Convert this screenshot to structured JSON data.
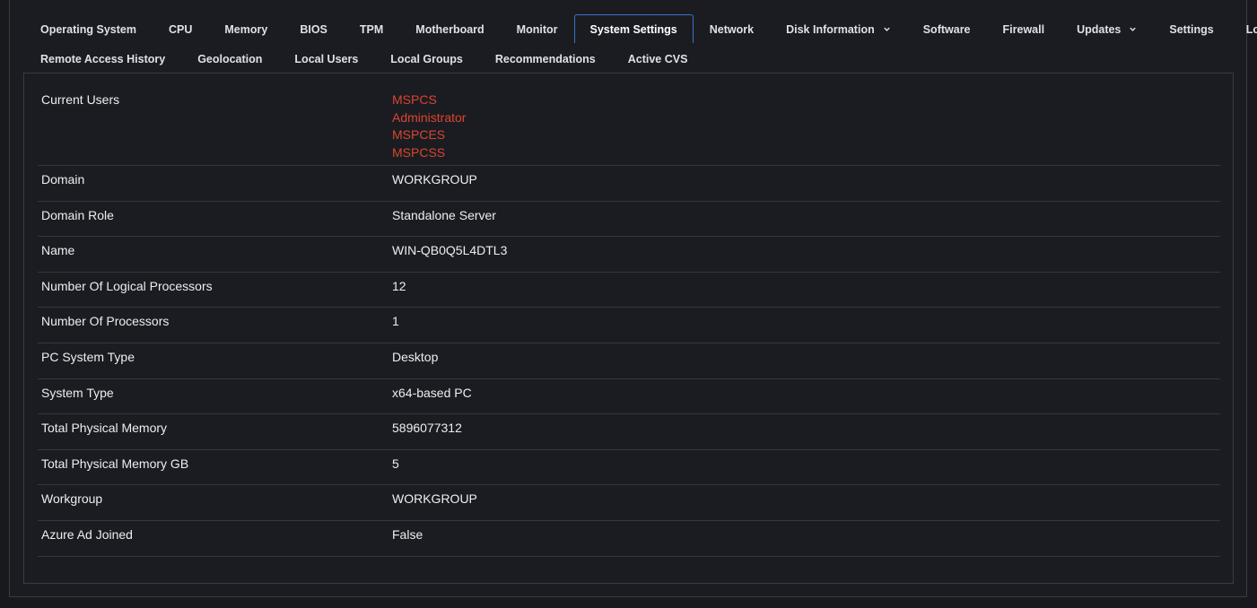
{
  "tabs": {
    "row1": [
      {
        "label": "Operating System"
      },
      {
        "label": "CPU"
      },
      {
        "label": "Memory"
      },
      {
        "label": "BIOS"
      },
      {
        "label": "TPM"
      },
      {
        "label": "Motherboard"
      },
      {
        "label": "Monitor"
      },
      {
        "label": "System Settings",
        "active": true
      },
      {
        "label": "Network"
      },
      {
        "label": "Disk Information",
        "dropdown": true
      },
      {
        "label": "Software"
      },
      {
        "label": "Firewall"
      },
      {
        "label": "Updates",
        "dropdown": true
      },
      {
        "label": "Settings"
      },
      {
        "label": "Location"
      }
    ],
    "row2": [
      {
        "label": "Remote Access History"
      },
      {
        "label": "Geolocation"
      },
      {
        "label": "Local Users"
      },
      {
        "label": "Local Groups"
      },
      {
        "label": "Recommendations"
      },
      {
        "label": "Active CVS"
      }
    ]
  },
  "system_settings": {
    "current_users": {
      "label": "Current Users",
      "values": [
        "MSPCS",
        "Administrator",
        "MSPCES",
        "MSPCSS"
      ]
    },
    "rows": [
      {
        "label": "Domain",
        "value": "WORKGROUP"
      },
      {
        "label": "Domain Role",
        "value": "Standalone Server"
      },
      {
        "label": "Name",
        "value": "WIN-QB0Q5L4DTL3"
      },
      {
        "label": "Number Of Logical Processors",
        "value": "12"
      },
      {
        "label": "Number Of Processors",
        "value": "1"
      },
      {
        "label": "PC System Type",
        "value": "Desktop"
      },
      {
        "label": "System Type",
        "value": "x64-based PC"
      },
      {
        "label": "Total Physical Memory",
        "value": "5896077312"
      },
      {
        "label": "Total Physical Memory GB",
        "value": "5"
      },
      {
        "label": "Workgroup",
        "value": "WORKGROUP"
      },
      {
        "label": "Azure Ad Joined",
        "value": "False"
      }
    ]
  },
  "colors": {
    "background": "#18191d",
    "active_tab_border": "#3e6fc9",
    "user_link": "#d9452f"
  }
}
